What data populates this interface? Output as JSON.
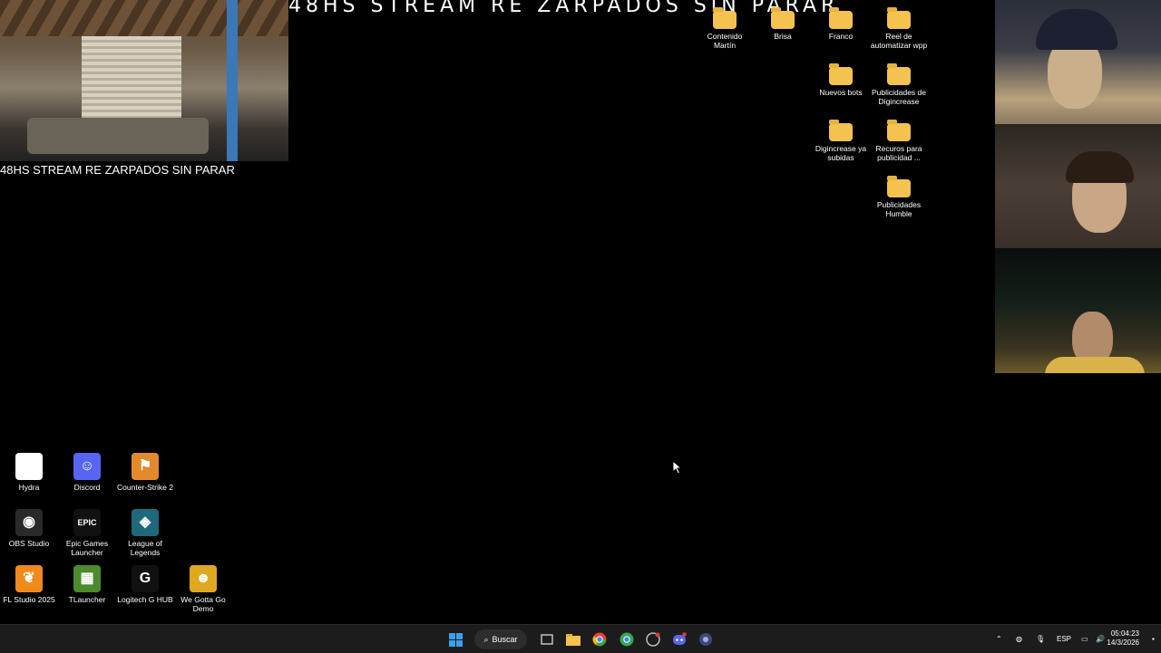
{
  "stream": {
    "caption": "48HS STREAM RE ZARPADOS SIN PARAR",
    "marquee": "48HS STREAM RE ZARPADOS SIN PARAR"
  },
  "desktop_icons_right": [
    {
      "label": "Contenido\nMartín"
    },
    {
      "label": "Brisa"
    },
    {
      "label": "Franco"
    },
    {
      "label": "Reel de\nautomatizar wpp"
    },
    {
      "label": "Nuevos bots"
    },
    {
      "label": "Publicidades de\nDigincrease"
    },
    {
      "label": "Digincrease ya\nsubidas"
    },
    {
      "label": "Recuros para\npublicidad ..."
    },
    {
      "label": "Publicidades\nHumble"
    }
  ],
  "desktop_icons_left": [
    {
      "label": "Hydra",
      "icon": "hydra-icon",
      "symbol": "✱",
      "color": "#ffffff"
    },
    {
      "label": "Discord",
      "icon": "discord-icon",
      "symbol": "☺",
      "color": "#5865f2"
    },
    {
      "label": "Counter-Strike 2",
      "icon": "counter-strike-icon",
      "symbol": "⚑",
      "color": "#e38b2c"
    },
    {
      "label": "OBS Studio",
      "icon": "obs-icon",
      "symbol": "◉",
      "color": "#2a2a2a"
    },
    {
      "label": "Epic Games\nLauncher",
      "icon": "epic-games-icon",
      "symbol": "EPIC",
      "color": "#111111"
    },
    {
      "label": "League of\nLegends",
      "icon": "league-icon",
      "symbol": "◈",
      "color": "#1f6a7a"
    },
    {
      "label": "FL Studio 2025",
      "icon": "fl-studio-icon",
      "symbol": "❦",
      "color": "#f08a1c"
    },
    {
      "label": "TLauncher",
      "icon": "tlauncher-icon",
      "symbol": "▦",
      "color": "#4c8a2e"
    },
    {
      "label": "Logitech G HUB",
      "icon": "logitech-icon",
      "symbol": "G",
      "color": "#111111"
    },
    {
      "label": "We Gotta Go\nDemo",
      "icon": "we-gotta-go-icon",
      "symbol": "☻",
      "color": "#e0a820"
    }
  ],
  "taskbar": {
    "search_label": "Buscar",
    "language": "ESP",
    "time": "05:04:23",
    "date": "14/3/2026"
  }
}
